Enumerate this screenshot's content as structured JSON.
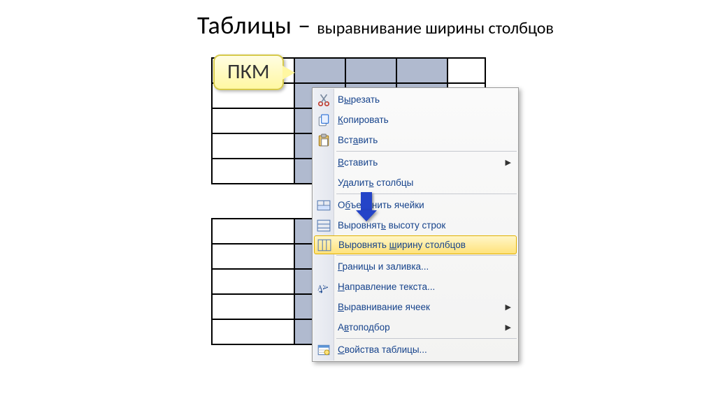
{
  "title": {
    "main": "Таблицы – ",
    "sub": "выравнивание ширины столбцов"
  },
  "callout": {
    "text": "ПКМ"
  },
  "menu": {
    "items": [
      {
        "kind": "item",
        "label": "В<u>ы</u>резать",
        "icon": "cut-icon"
      },
      {
        "kind": "item",
        "label": "<u>К</u>опировать",
        "icon": "copy-icon"
      },
      {
        "kind": "item",
        "label": "Вст<u>а</u>вить",
        "icon": "paste-icon"
      },
      {
        "kind": "sep"
      },
      {
        "kind": "item",
        "label": "<u>В</u>ставить",
        "submenu": true
      },
      {
        "kind": "item",
        "label": "Удалит<u>ь</u> столбцы"
      },
      {
        "kind": "sep"
      },
      {
        "kind": "item",
        "label": "О<u>б</u>ъединить ячейки",
        "icon": "merge-icon"
      },
      {
        "kind": "item",
        "label": "Выровнят<u>ь</u> высоту строк",
        "icon": "row-height-icon"
      },
      {
        "kind": "item",
        "label": "Выровнять <u>ш</u>ирину столбцов",
        "icon": "col-width-icon",
        "highlight": true
      },
      {
        "kind": "sep"
      },
      {
        "kind": "item",
        "label": "<u>Г</u>раницы и заливка..."
      },
      {
        "kind": "item",
        "label": "<u>Н</u>аправление текста...",
        "icon": "text-dir-icon"
      },
      {
        "kind": "item",
        "label": "<u>В</u>ыравнивание ячеек",
        "submenu": true
      },
      {
        "kind": "item",
        "label": "А<u>в</u>топодбор",
        "submenu": true
      },
      {
        "kind": "sep"
      },
      {
        "kind": "item",
        "label": "<u>С</u>войства таблицы...",
        "icon": "table-props-icon"
      }
    ]
  }
}
